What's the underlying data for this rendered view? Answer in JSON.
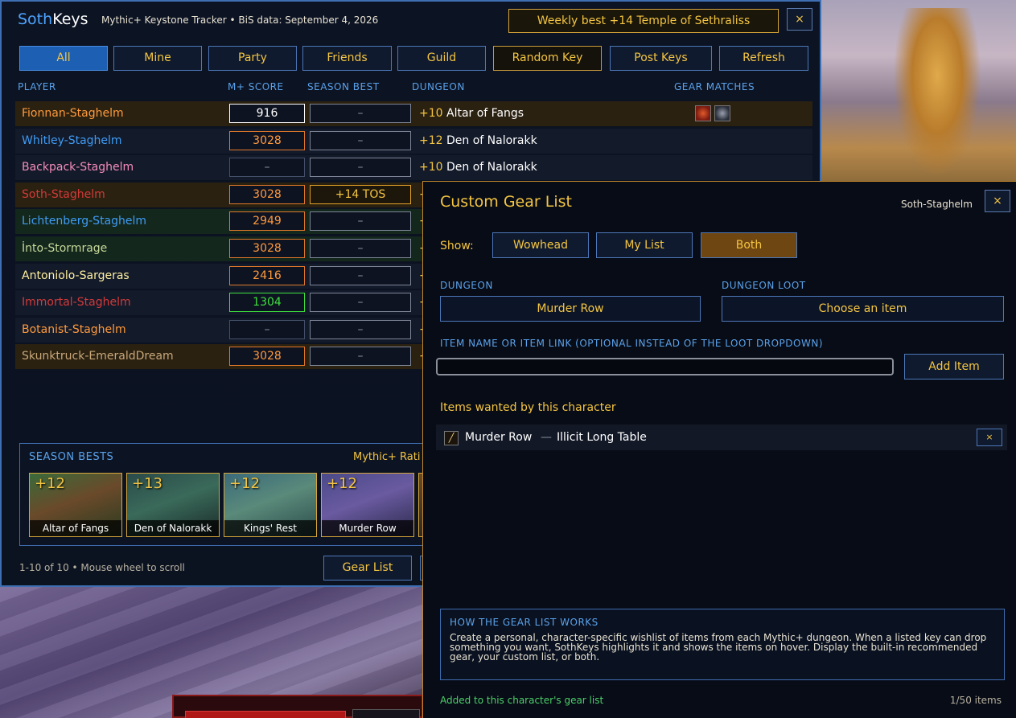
{
  "app": {
    "brand_part1": "Soth",
    "brand_part2": "Keys",
    "subtitle": "Mythic+ Keystone Tracker  •  BiS data: September 4, 2026",
    "weekly_best": "Weekly best  +14  Temple of Sethraliss",
    "close_label": "×"
  },
  "tabs": [
    {
      "label": "All",
      "active": true
    },
    {
      "label": "Mine"
    },
    {
      "label": "Party"
    },
    {
      "label": "Friends"
    },
    {
      "label": "Guild"
    },
    {
      "label": "Random Key"
    },
    {
      "label": "Post Keys"
    },
    {
      "label": "Refresh"
    }
  ],
  "columns": {
    "player": "PLAYER",
    "score": "M+ SCORE",
    "season_best": "SEASON BEST",
    "dungeon": "DUNGEON",
    "gear": "GEAR MATCHES"
  },
  "rows": [
    {
      "name": "Fionnan-Staghelm",
      "name_color": "#ff9a3c",
      "score": "916",
      "best": "–",
      "level": "+10",
      "dungeon": "Altar of Fangs"
    },
    {
      "name": "Whitley-Staghelm",
      "name_color": "#3f9cf5",
      "score": "3028",
      "best": "–",
      "level": "+12",
      "dungeon": "Den of Nalorakk"
    },
    {
      "name": "Backpack-Staghelm",
      "name_color": "#f58cba",
      "score": "–",
      "best": "–",
      "level": "+10",
      "dungeon": "Den of Nalorakk"
    },
    {
      "name": "Soth-Staghelm",
      "name_color": "#d23a3a",
      "score": "3028",
      "best": "+14 TOS",
      "level": "+",
      "dungeon": ""
    },
    {
      "name": "Lichtenberg-Staghelm",
      "name_color": "#3f9cf5",
      "score": "2949",
      "best": "–",
      "level": "+",
      "dungeon": ""
    },
    {
      "name": "İnto-Stormrage",
      "name_color": "#c6d89a",
      "score": "3028",
      "best": "–",
      "level": "+",
      "dungeon": ""
    },
    {
      "name": "Antoniolo-Sargeras",
      "name_color": "#fff0a0",
      "score": "2416",
      "best": "–",
      "level": "+",
      "dungeon": ""
    },
    {
      "name": "Immortal-Staghelm",
      "name_color": "#d23a3a",
      "score": "1304",
      "best": "–",
      "level": "+",
      "dungeon": ""
    },
    {
      "name": "Botanist-Staghelm",
      "name_color": "#ff9a3c",
      "score": "–",
      "best": "–",
      "level": "+",
      "dungeon": ""
    },
    {
      "name": "Skunktruck-EmeraldDream",
      "name_color": "#c7a77a",
      "score": "3028",
      "best": "–",
      "level": "+",
      "dungeon": ""
    }
  ],
  "season": {
    "title": "SEASON BESTS",
    "rating": "Mythic+ Rati",
    "cards": [
      {
        "level": "+12",
        "name": "Altar of Fangs"
      },
      {
        "level": "+13",
        "name": "Den of Nalorakk"
      },
      {
        "level": "+12",
        "name": "Kings' Rest"
      },
      {
        "level": "+12",
        "name": "Murder Row"
      }
    ]
  },
  "footer": {
    "count": "1-10 of 10  •  Mouse wheel to scroll",
    "gear_list_button": "Gear List"
  },
  "panel": {
    "title": "Custom Gear List",
    "character": "Soth-Staghelm",
    "show_label": "Show:",
    "show_options": [
      "Wowhead",
      "My List",
      "Both"
    ],
    "show_selected": "Both",
    "dungeon_label": "DUNGEON",
    "dungeon_value": "Murder Row",
    "loot_label": "DUNGEON LOOT",
    "loot_value": "Choose an item",
    "item_label": "ITEM NAME OR ITEM LINK (OPTIONAL INSTEAD OF THE LOOT DROPDOWN)",
    "item_value": "",
    "add_button": "Add Item",
    "items_heading": "Items wanted by this character",
    "items": [
      {
        "dungeon": "Murder Row",
        "sep": "—",
        "name": "Illicit Long Table",
        "remove": "×"
      }
    ],
    "how_title": "HOW THE GEAR LIST WORKS",
    "how_text": "Create a personal, character-specific wishlist of items from each Mythic+ dungeon. When a listed key can drop something you want, SothKeys highlights it and shows the items on hover. Display the built-in recommended gear, your custom list, or both.",
    "status": "Added to this character's gear list",
    "count": "1/50 items"
  },
  "colors": {
    "accent_gold": "#f4c542",
    "accent_blue": "#5aa2ea",
    "frame_blue": "#3e6fb3"
  }
}
